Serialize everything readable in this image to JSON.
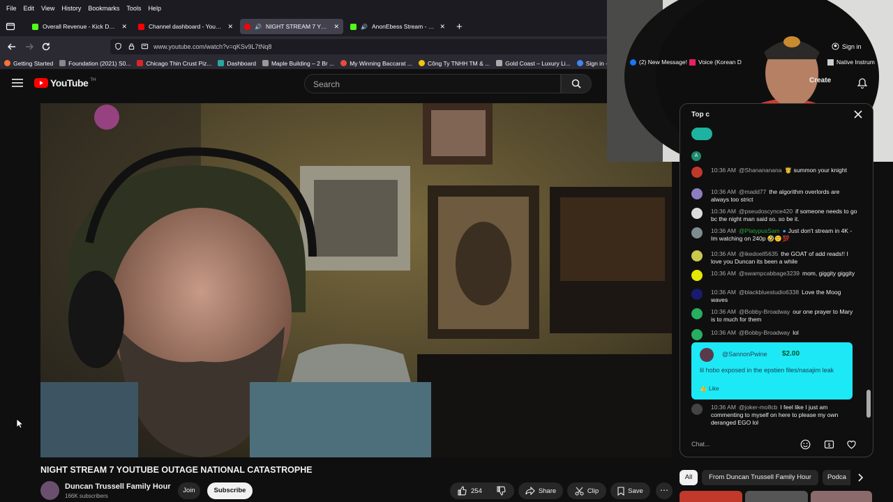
{
  "menu": [
    "File",
    "Edit",
    "View",
    "History",
    "Bookmarks",
    "Tools",
    "Help"
  ],
  "tabs": [
    {
      "title": "Overall Revenue - Kick Dashboa",
      "color": "#53fc18",
      "active": false
    },
    {
      "title": "Channel dashboard - YouTube S",
      "color": "#ff0000",
      "active": false
    },
    {
      "title": "NIGHT STREAM 7 YOUTUBE",
      "color": "#ff0000",
      "active": true
    },
    {
      "title": "AnonEbess Stream - Watch",
      "color": "#53fc18",
      "active": false
    }
  ],
  "url": "www.youtube.com/watch?v=qKSv9L7tNq8",
  "bookmarks": [
    {
      "label": "Getting Started",
      "color": "#ff7139"
    },
    {
      "label": "Foundation (2021) S0...",
      "color": "#888888"
    },
    {
      "label": "Chicago Thin Crust Piz...",
      "color": "#d9252a"
    },
    {
      "label": "Dashboard",
      "color": "#2aa7a0"
    },
    {
      "label": "Maple Building – 2 Br ...",
      "color": "#999999"
    },
    {
      "label": "My Winning Baccarat ...",
      "color": "#e74c3c"
    },
    {
      "label": "Công Ty TNHH TM & ...",
      "color": "#f1c40f"
    },
    {
      "label": "Gold Coast – Luxury Li...",
      "color": "#aaaaaa"
    },
    {
      "label": "Sign in - Drea",
      "color": "#4285f4"
    },
    {
      "label": "(2) New Message!",
      "color": "#1877f2"
    },
    {
      "label": "Voice (Korean D",
      "color": "#e91e63"
    },
    {
      "label": "Native Instrum",
      "color": "#cccccc"
    }
  ],
  "youtube": {
    "logo": "YouTube",
    "logo_sup": "TH",
    "search_placeholder": "Search",
    "create_label": "Create",
    "signin_label": "Sign in"
  },
  "video": {
    "title": "NIGHT STREAM 7 YOUTUBE OUTAGE NATIONAL CATASTROPHE",
    "channel": "Duncan Trussell Family Hour",
    "subscribers": "166K subscribers",
    "join_label": "Join",
    "subscribe_label": "Subscribe",
    "likes": "254",
    "share_label": "Share",
    "clip_label": "Clip",
    "save_label": "Save"
  },
  "chat": {
    "header": "Top c",
    "input_placeholder": "Chat...",
    "messages": [
      {
        "time": "10:36 AM",
        "user": "@Shanananana",
        "text": "🤴 summon your knight",
        "color": "#c0392b"
      },
      {
        "time": "10:36 AM",
        "user": "@madd77",
        "text": "the algorithm overlords are always too strict",
        "color": "#8e7cc3"
      },
      {
        "time": "10:36 AM",
        "user": "@pseudoscynce420",
        "text": "if someone needs to go bc the night man said so. so be it.",
        "color": "#dddddd"
      },
      {
        "time": "10:36 AM",
        "user": "@PlatypusSam",
        "text": "Just don't stream in 4K - Im watching on 240p 🤣🙂💯",
        "color": "#7f8c8d",
        "member": true
      },
      {
        "time": "10:36 AM",
        "user": "@ikedoell5635",
        "text": "the GOAT of add reads!! I love you Duncan its been a while",
        "color": "#c9c94c"
      },
      {
        "time": "10:36 AM",
        "user": "@swampcabbage3239",
        "text": "mom, giggity giggity",
        "color": "#e6e600"
      },
      {
        "time": "10:36 AM",
        "user": "@blackbluestudio6338",
        "text": "Love the Moog waves",
        "color": "#1a1a6e"
      },
      {
        "time": "10:36 AM",
        "user": "@Bobby-Broadway",
        "text": "our one prayer to Mary is to much for them",
        "color": "#27ae60"
      },
      {
        "time": "10:36 AM",
        "user": "@Bobby-Broadway",
        "text": "lol",
        "color": "#27ae60"
      }
    ],
    "superchat": {
      "user": "@SannonPwine",
      "amount": "$2.00",
      "text": "lil hobo exposed in the epstien files/nasajim leak",
      "like_label": "Like"
    },
    "last": {
      "time": "10:36 AM",
      "user": "@joker-mo8cb",
      "text": "I feel like I just am commenting to myself on here to please my own deranged EGO lol"
    }
  },
  "chips": [
    "All",
    "From Duncan Trussell Family Hour",
    "Podca"
  ]
}
